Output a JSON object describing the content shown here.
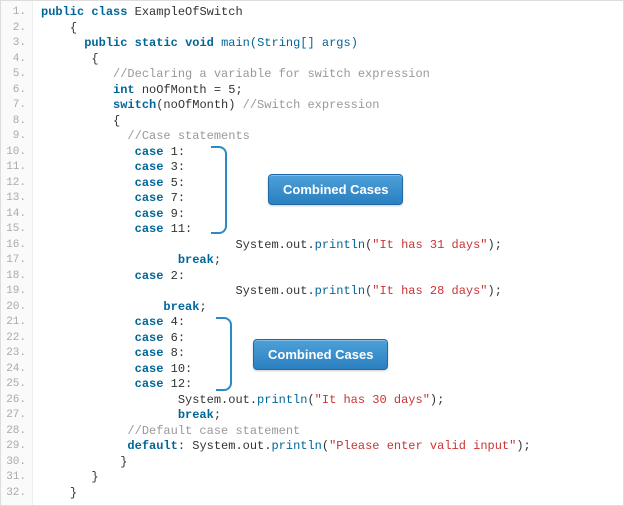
{
  "line_numbers": [
    "1.",
    "2.",
    "3.",
    "4.",
    "5.",
    "6.",
    "7.",
    "8.",
    "9.",
    "10.",
    "11.",
    "12.",
    "13.",
    "14.",
    "15.",
    "16.",
    "17.",
    "18.",
    "19.",
    "20.",
    "21.",
    "22.",
    "23.",
    "24.",
    "25.",
    "26.",
    "27.",
    "28.",
    "29.",
    "30.",
    "31.",
    "32."
  ],
  "kw": {
    "public": "public",
    "class": "class",
    "static": "static",
    "void": "void",
    "int": "int",
    "switch": "switch",
    "case": "case",
    "break": "break",
    "default": "default"
  },
  "code": {
    "class_name": "ExampleOfSwitch",
    "main_sig_open": "main(String[] args)",
    "cmt_declare": "//Declaring a variable for switch expression",
    "var_decl": " noOfMonth = ",
    "var_val": "5",
    "semicolon": ";",
    "switch_open": "(noOfMonth) ",
    "cmt_switch": "//Switch expression",
    "cmt_cases": "//Case statements",
    "c1": " 1:",
    "c3": " 3:",
    "c5": " 5:",
    "c7": " 7:",
    "c9": " 9:",
    "c11": " 11:",
    "c2": " 2:",
    "c4": " 4:",
    "c6": " 6:",
    "c8": " 8:",
    "c10": " 10:",
    "c12": " 12:",
    "sysout_prefix": "System.out.",
    "println": "println",
    "str31": "\"It has 31 days\"",
    "str28": "\"It has 28 days\"",
    "str30": "\"It has 30 days\"",
    "strdef": "\"Please enter valid input\"",
    "close_paren_semi": ");",
    "cmt_default": "//Default case statement",
    "default_colon": ": ",
    "obrace": "{",
    "cbrace": "}"
  },
  "badges": {
    "b1": "Combined Cases",
    "b2": "Combined Cases"
  }
}
